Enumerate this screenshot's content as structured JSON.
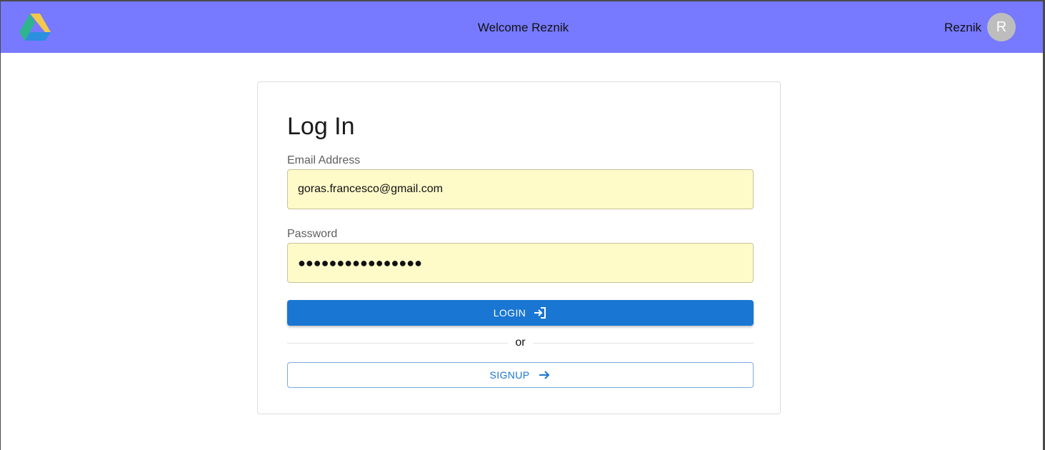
{
  "header": {
    "welcome_text": "Welcome Reznik",
    "user_name": "Reznik",
    "avatar_initial": "R",
    "logo_icon": "drive-logo-icon",
    "background_color": "#7779fe"
  },
  "login_form": {
    "title": "Log In",
    "email_label": "Email Address",
    "email_value": "goras.francesco@gmail.com",
    "password_label": "Password",
    "password_value": "●●●●●●●●●●●●●●●●",
    "login_button_label": "LOGIN",
    "login_button_icon": "login-icon",
    "divider_text": "or",
    "signup_button_label": "SIGNUP",
    "signup_button_icon": "arrow-right-icon",
    "field_background": "#fffbc9",
    "primary_color": "#1976d2"
  }
}
